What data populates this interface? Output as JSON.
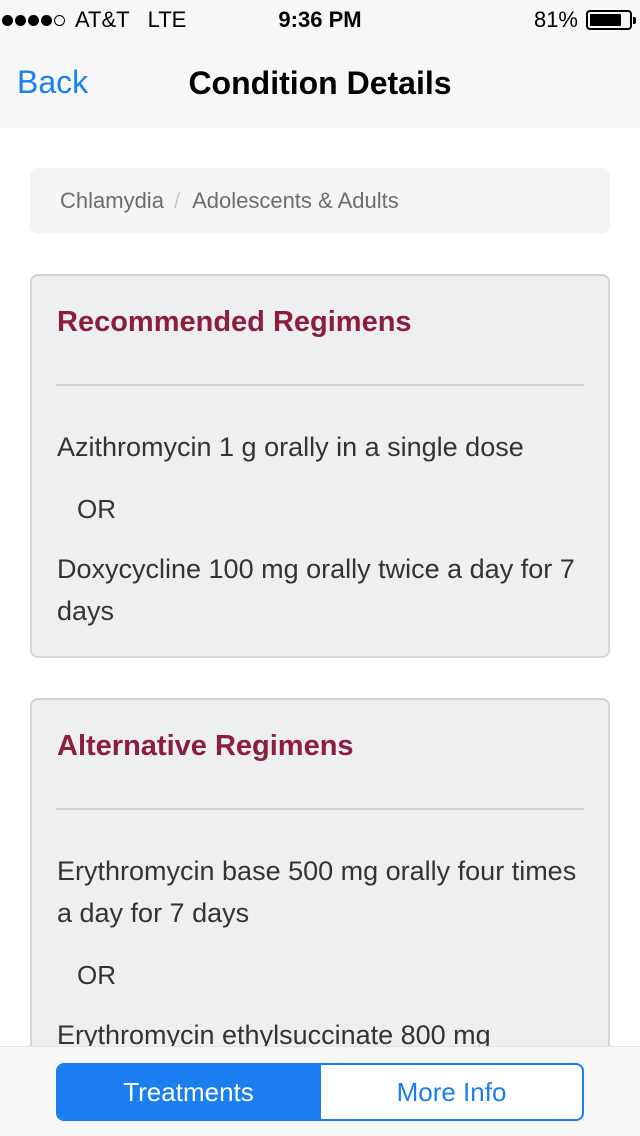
{
  "status_bar": {
    "carrier": "AT&T",
    "network": "LTE",
    "time": "9:36 PM",
    "battery": "81%",
    "battery_level": 0.81,
    "signal_bars": 4,
    "signal_max": 5
  },
  "nav": {
    "back_label": "Back",
    "title": "Condition Details"
  },
  "breadcrumb": {
    "items": [
      "Chlamydia",
      "Adolescents & Adults"
    ],
    "separator": "/"
  },
  "panels": [
    {
      "title": "Recommended Regimens",
      "entries": [
        "Azithromycin 1 g orally in a single dose",
        "OR",
        "Doxycycline 100 mg orally twice a day for 7 days"
      ]
    },
    {
      "title": "Alternative Regimens",
      "entries": [
        "Erythromycin base 500 mg orally four times a day for 7 days",
        "OR",
        "Erythromycin ethylsuccinate 800 mg"
      ]
    }
  ],
  "tabs": {
    "items": [
      "Treatments",
      "More Info"
    ],
    "selected": "Treatments"
  },
  "colors": {
    "accent": "#1a7ef0",
    "panel_title": "#8c1e3a",
    "panel_bg": "#eeeff1"
  }
}
